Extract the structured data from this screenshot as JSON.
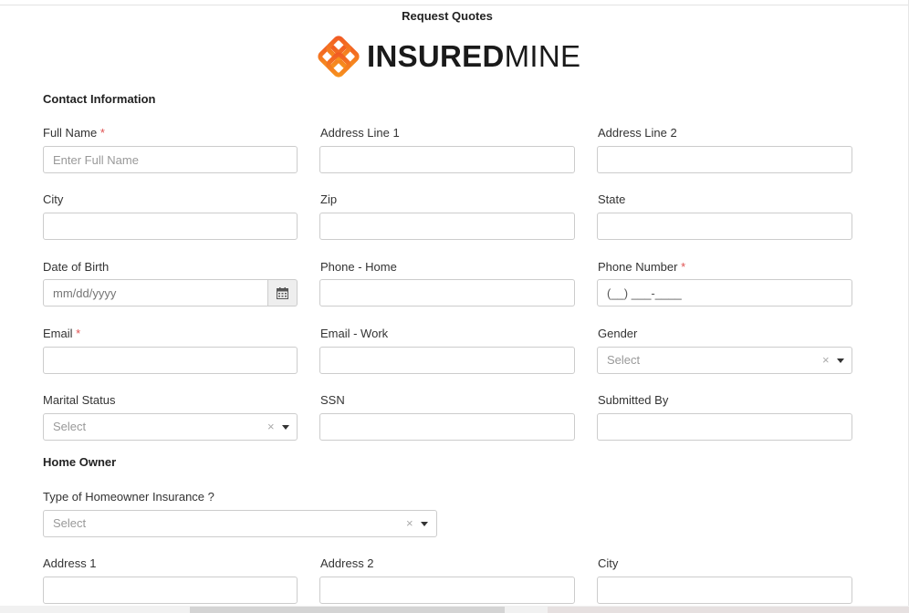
{
  "page_title": "Request Quotes",
  "logo": {
    "bold": "INSURED",
    "light": "MINE",
    "colors": [
      "#f15a24",
      "#f7931e"
    ]
  },
  "sections": {
    "contact": "Contact Information",
    "home_owner": "Home Owner"
  },
  "fields": {
    "full_name": {
      "label": "Full Name",
      "required": "*",
      "placeholder": "Enter Full Name"
    },
    "address_line_1": {
      "label": "Address Line 1"
    },
    "address_line_2": {
      "label": "Address Line 2"
    },
    "city": {
      "label": "City"
    },
    "zip": {
      "label": "Zip"
    },
    "state": {
      "label": "State"
    },
    "dob": {
      "label": "Date of Birth",
      "placeholder": "mm/dd/yyyy",
      "icon": "calendar-icon"
    },
    "phone_home": {
      "label": "Phone - Home"
    },
    "phone_number": {
      "label": "Phone Number",
      "required": "*",
      "value": "(__) ___-____"
    },
    "email": {
      "label": "Email",
      "required": "*"
    },
    "email_work": {
      "label": "Email - Work"
    },
    "gender": {
      "label": "Gender",
      "placeholder": "Select",
      "clear": "×"
    },
    "marital_status": {
      "label": "Marital Status",
      "placeholder": "Select",
      "clear": "×"
    },
    "ssn": {
      "label": "SSN"
    },
    "submitted_by": {
      "label": "Submitted By"
    },
    "homeowner_type": {
      "label": "Type of Homeowner Insurance ?",
      "placeholder": "Select",
      "clear": "×"
    },
    "address_1": {
      "label": "Address 1"
    },
    "address_2": {
      "label": "Address 2"
    },
    "home_city": {
      "label": "City"
    }
  }
}
